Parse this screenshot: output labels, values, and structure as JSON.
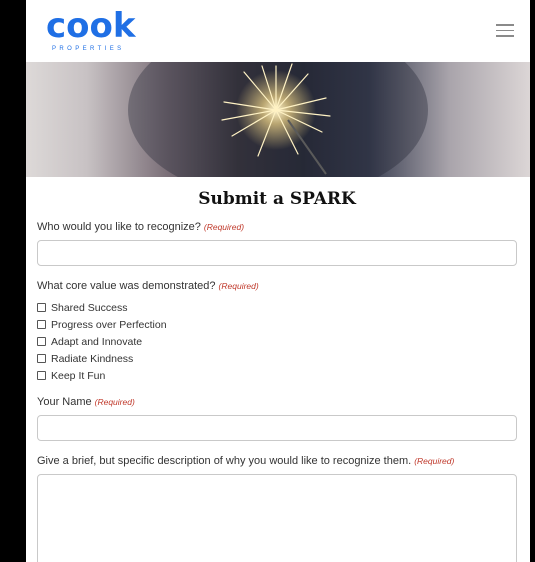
{
  "header": {
    "logo_word": "cook",
    "logo_sub": "PROPERTIES",
    "menu_icon": "hamburger-menu-icon"
  },
  "hero": {
    "image_subject": "sparkler"
  },
  "form": {
    "title": "Submit a SPARK",
    "required_tag": "(Required)",
    "recognize_label": "Who would you like to recognize?",
    "core_value_label": "What core value was demonstrated?",
    "core_values": [
      "Shared Success",
      "Progress over Perfection",
      "Adapt and Innovate",
      "Radiate Kindness",
      "Keep It Fun"
    ],
    "name_label": "Your Name",
    "description_label": "Give a brief, but specific description of why you would like to recognize them."
  },
  "colors": {
    "brand": "#1f6fe5",
    "required": "#c0392b",
    "background": "#000000"
  }
}
